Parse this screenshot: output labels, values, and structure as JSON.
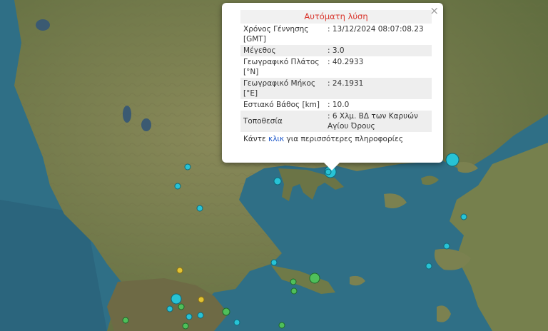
{
  "popup": {
    "title": "Αυτόματη λύση",
    "close": "×",
    "rows": [
      {
        "label": "Χρόνος Γέννησης [GMT]",
        "value": ": 13/12/2024 08:07:08.23"
      },
      {
        "label": "Μέγεθος",
        "value": ": 3.0"
      },
      {
        "label": "Γεωγραφικό Πλάτος [°N]",
        "value": ": 40.2933"
      },
      {
        "label": "Γεωγραφικό Μήκος [°E]",
        "value": ": 24.1931"
      },
      {
        "label": "Εστιακό Βάθος [km]",
        "value": ": 10.0"
      },
      {
        "label": "Τοποθεσία",
        "value": ": 6 Χλμ. ΒΔ των Καρυών Αγίου Όρους"
      }
    ],
    "more_before": "Κάντε ",
    "more_link": "κλικ",
    "more_after": " για περισσότερες πληροφορίες"
  },
  "colors": {
    "sea": "#2f6f86",
    "marker_cyan": "#27c3d6",
    "marker_green": "#4fbf5a",
    "marker_yellow": "#e2c232",
    "title_red": "#d9342b"
  },
  "markers": {
    "icon": "earthquake-marker-icon"
  }
}
